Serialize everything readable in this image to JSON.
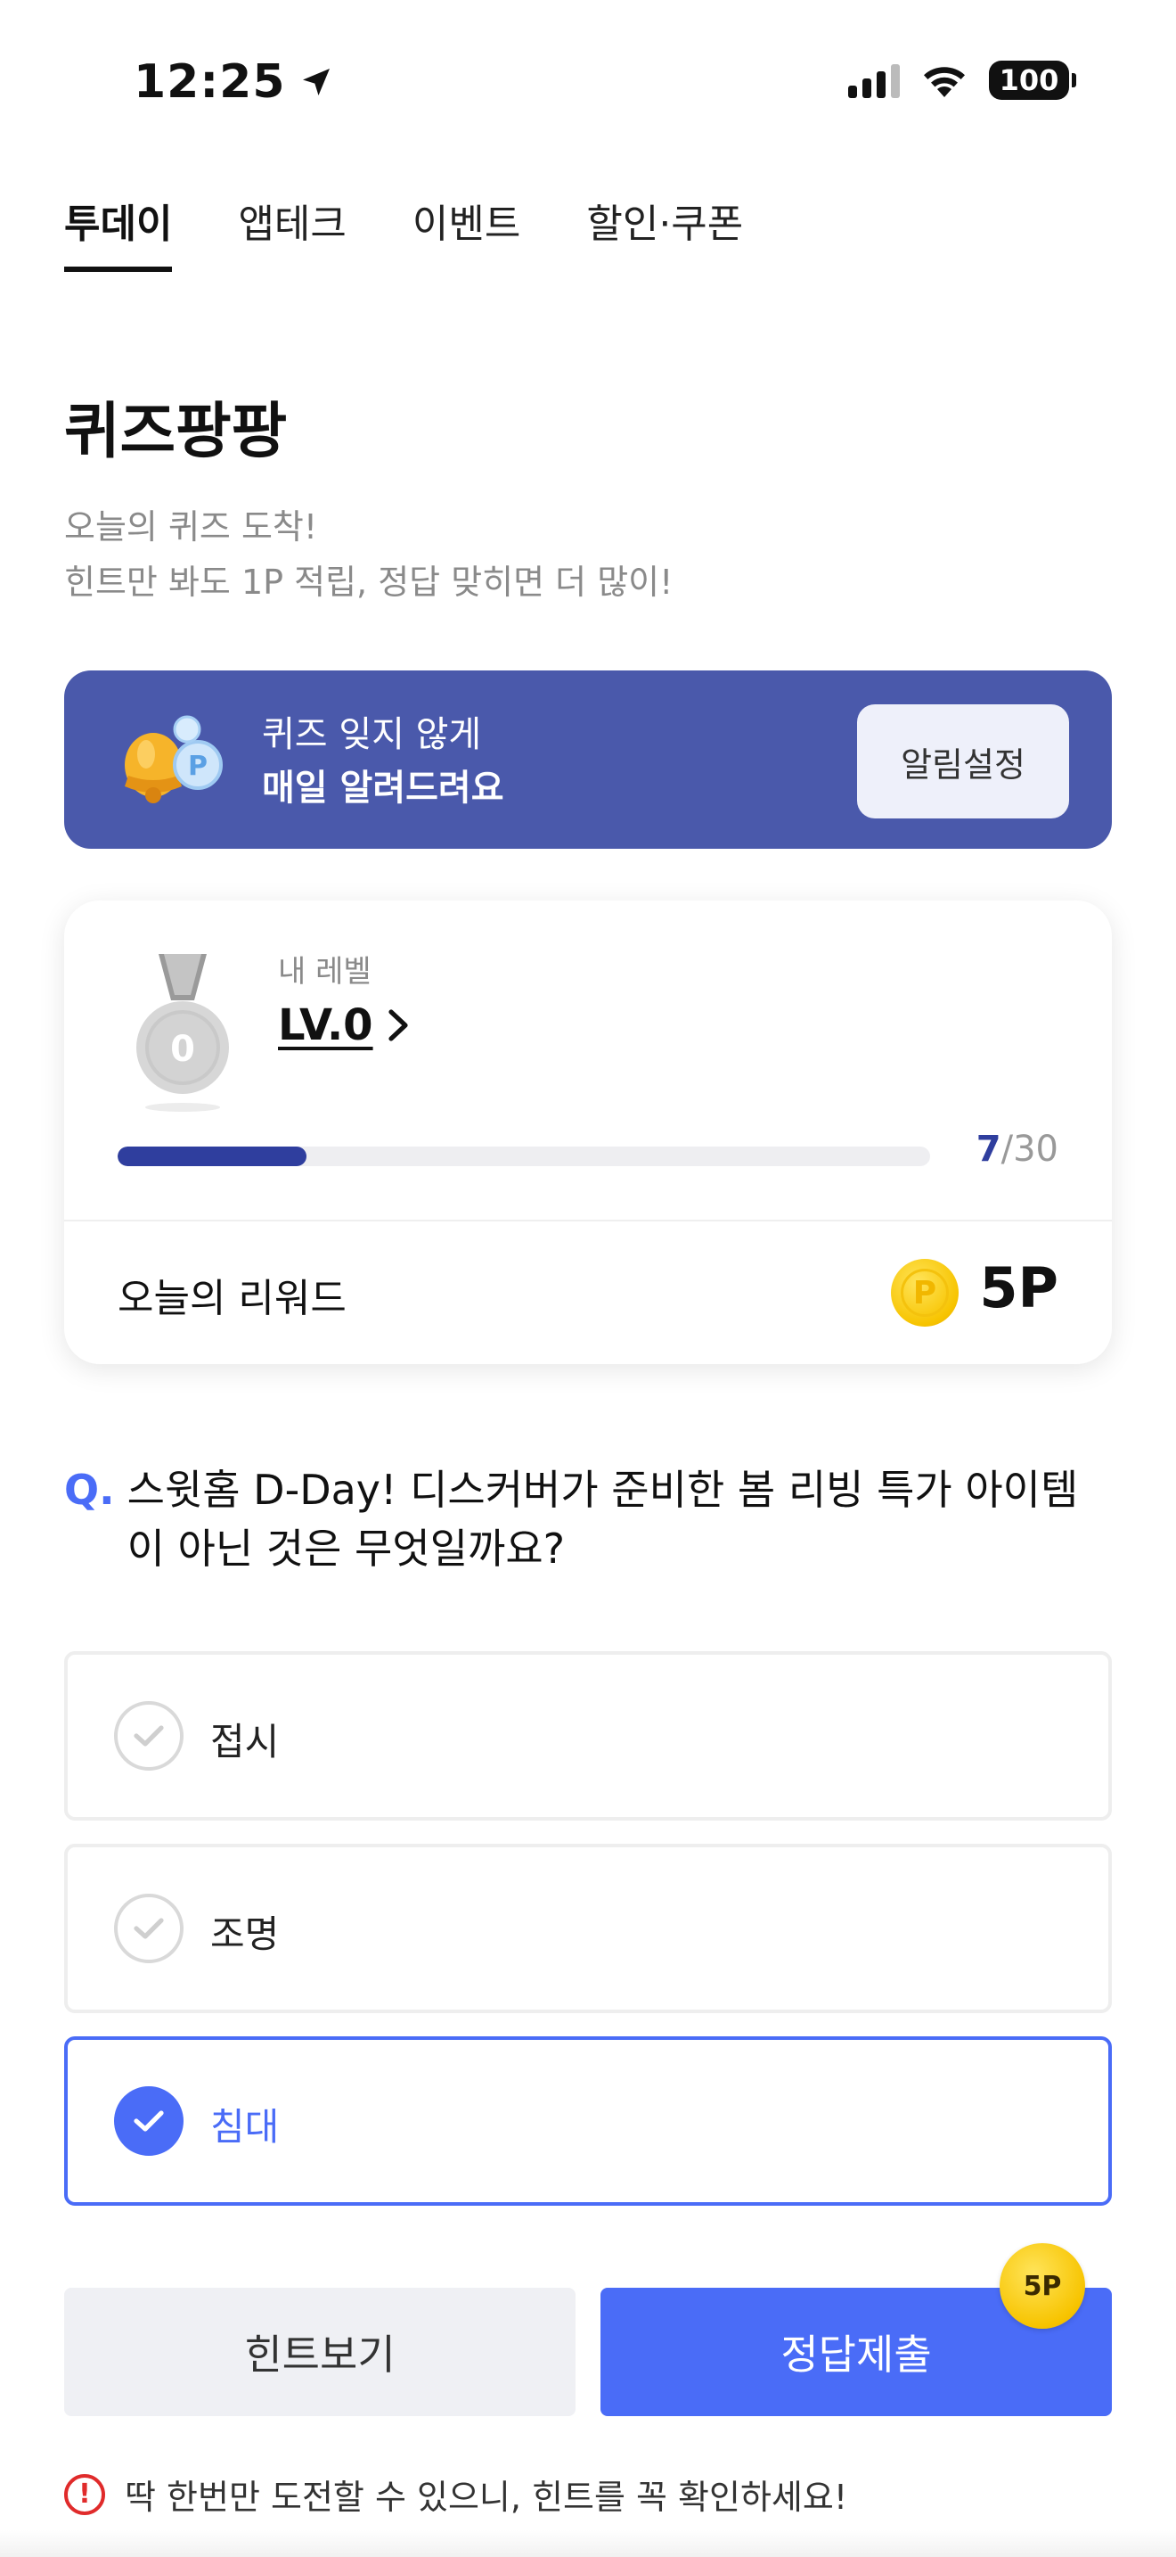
{
  "status_bar": {
    "time": "12:25",
    "battery": "100"
  },
  "tabs": [
    {
      "label": "투데이",
      "active": true
    },
    {
      "label": "앱테크",
      "active": false
    },
    {
      "label": "이벤트",
      "active": false
    },
    {
      "label": "할인·쿠폰",
      "active": false
    }
  ],
  "page": {
    "title": "퀴즈팡팡",
    "subtitle_line1": "오늘의 퀴즈 도착!",
    "subtitle_line2": "힌트만 봐도 1P 적립, 정답 맞히면 더 많이!"
  },
  "banner": {
    "line1": "퀴즈 잊지 않게",
    "line2": "매일 알려드려요",
    "button_label": "알림설정",
    "background_color": "#4a59ab"
  },
  "level_card": {
    "label": "내 레벨",
    "level": "LV.0",
    "medal_number": "0",
    "progress_current": "7",
    "progress_separator": "/",
    "progress_total": "30",
    "progress_fraction": 0.233,
    "reward_label": "오늘의 리워드",
    "coin_letter": "P",
    "reward_value": "5P"
  },
  "question": {
    "prefix": "Q.",
    "text": "스윗홈 D-Day! 디스커버가 준비한 봄 리빙 특가 아이템이 아닌 것은 무엇일까요?"
  },
  "options": [
    {
      "label": "접시",
      "selected": false
    },
    {
      "label": "조명",
      "selected": false
    },
    {
      "label": "침대",
      "selected": true
    }
  ],
  "buttons": {
    "hint_label": "힌트보기",
    "submit_label": "정답제출",
    "submit_badge": "5P"
  },
  "notice": {
    "icon_text": "!",
    "text": "딱 한번만 도전할 수 있으니, 힌트를 꼭 확인하세요!"
  },
  "colors": {
    "accent": "#4a6cf7",
    "progress": "#2f3e9e",
    "warning": "#e02b2b"
  }
}
